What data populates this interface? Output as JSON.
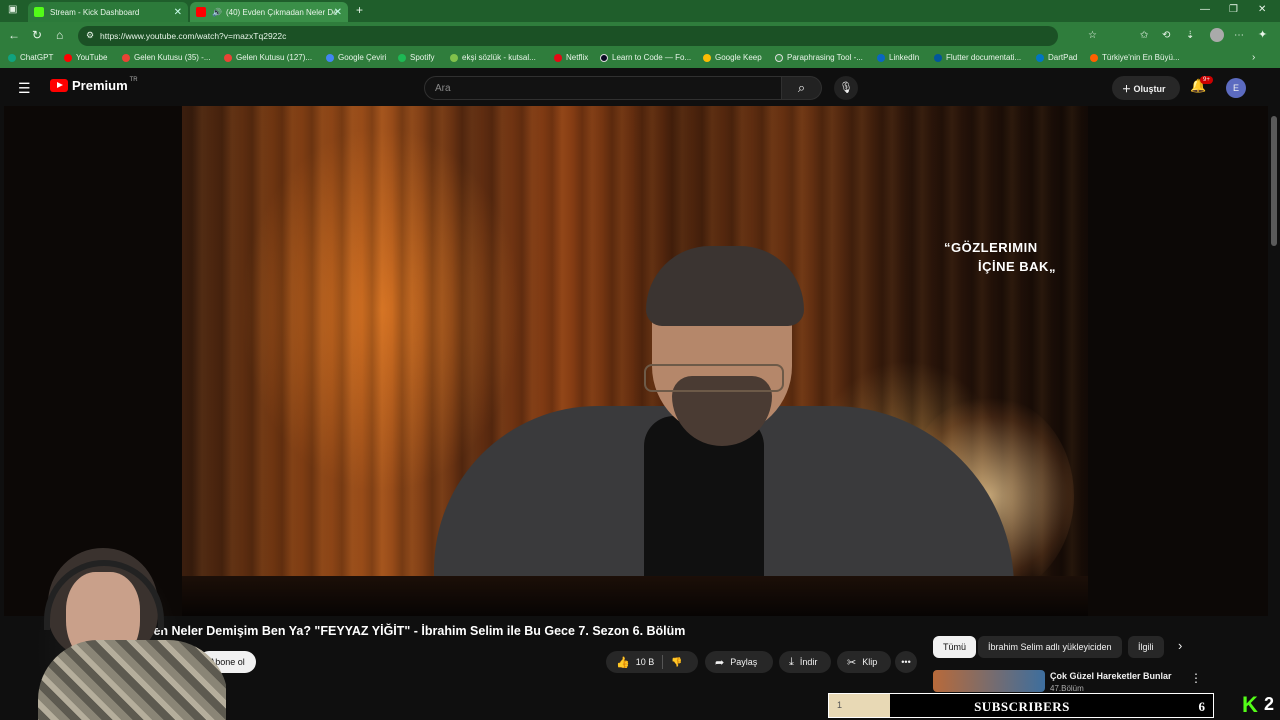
{
  "browser": {
    "tabs": [
      {
        "label": "Stream - Kick Dashboard",
        "favicon_color": "#53fc18"
      },
      {
        "label": "(40) Evden Çıkmadan Neler De",
        "favicon_color": "#ff0000"
      }
    ],
    "url": "https://www.youtube.com/watch?v=mazxTq2922c",
    "bookmarks": [
      {
        "label": "ChatGPT",
        "color": "#10a37f"
      },
      {
        "label": "YouTube",
        "color": "#ff0000"
      },
      {
        "label": "Gelen Kutusu (35) -...",
        "color": "#ea4335"
      },
      {
        "label": "Gelen Kutusu (127)...",
        "color": "#ea4335"
      },
      {
        "label": "Google Çeviri",
        "color": "#4285f4"
      },
      {
        "label": "Spotify",
        "color": "#1db954"
      },
      {
        "label": "ekşi sözlük - kutsal...",
        "color": "#81c14b"
      },
      {
        "label": "Netflix",
        "color": "#e50914"
      },
      {
        "label": "Learn to Code — Fo...",
        "color": "#0a0a23"
      },
      {
        "label": "Google Keep",
        "color": "#fbbc04"
      },
      {
        "label": "Paraphrasing Tool -...",
        "color": "#3a8f48"
      },
      {
        "label": "LinkedIn",
        "color": "#0a66c2"
      },
      {
        "label": "Flutter documentati...",
        "color": "#02569b"
      },
      {
        "label": "DartPad",
        "color": "#0175c2"
      },
      {
        "label": "Türkiye'nin En Büyü...",
        "color": "#ff6000"
      }
    ]
  },
  "youtube": {
    "logo_text": "Premium",
    "region": "TR",
    "search_placeholder": "Ara",
    "create_label": "Oluştur",
    "notification_badge": "9+",
    "avatar_letter": "E"
  },
  "video": {
    "overlay_line1": "GÖZLERIMIN",
    "overlay_line2": "İÇİNE BAK",
    "title": "len Neler Demişim Ben Ya? \"FEYYAZ YİĞİT\" - İbrahim Selim ile Bu Gece 7. Sezon 6. Bölüm",
    "subscribe_label": "Abone ol",
    "like_count": "10 B",
    "share_label": "Paylaş",
    "download_label": "İndir",
    "clip_label": "Klip"
  },
  "sidebar": {
    "chips": [
      "Tümü",
      "İbrahim Selim adlı yükleyiciden",
      "İlgili"
    ],
    "related_title": "Çok Güzel Hareketler Bunlar",
    "related_sub": "47.Bölüm"
  },
  "stream_overlay": {
    "subs_current": "1",
    "subs_label": "SUBSCRIBERS",
    "subs_goal": "6",
    "subs_progress": 0.16,
    "kick_count": "2"
  }
}
